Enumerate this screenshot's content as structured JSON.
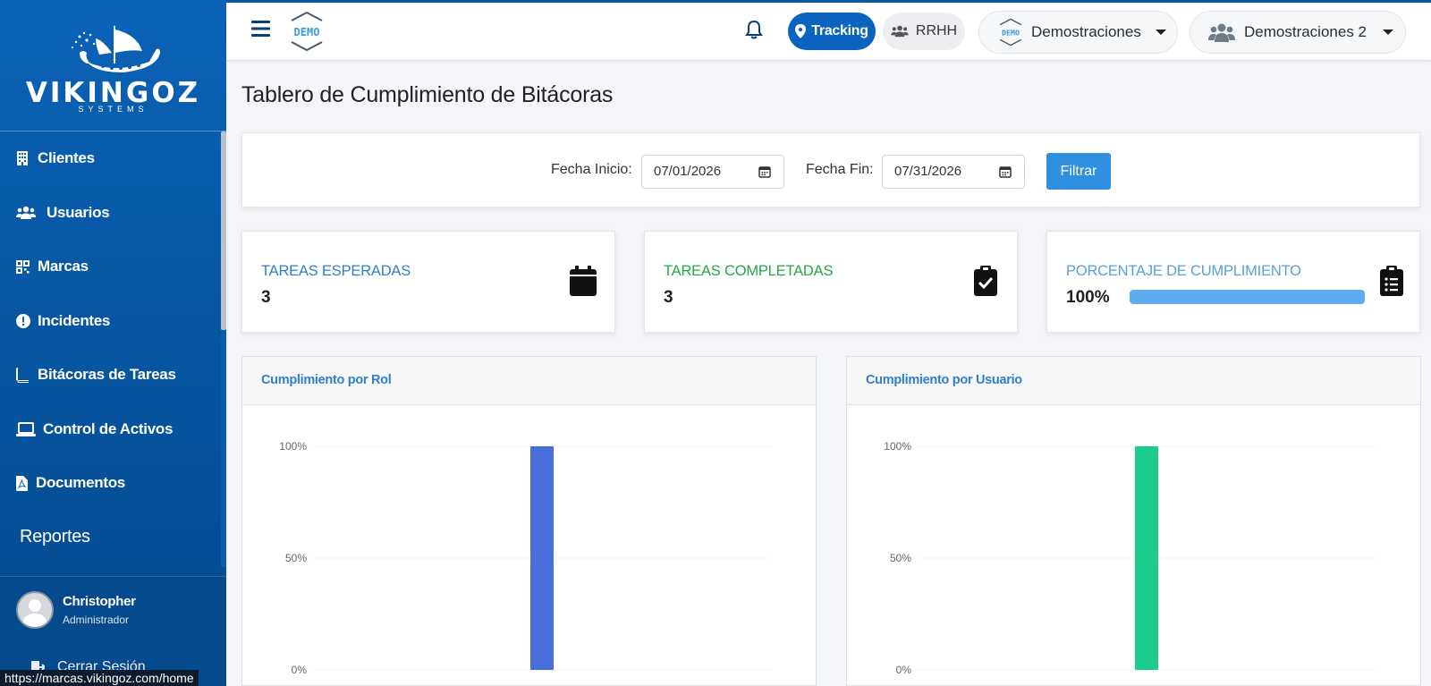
{
  "sidebar": {
    "brand": "VIKINGOZ",
    "brand_sub": "SYSTEMS",
    "items": [
      {
        "label": "Clientes",
        "icon": "building-icon"
      },
      {
        "label": "Usuarios",
        "icon": "users-icon"
      },
      {
        "label": "Marcas",
        "icon": "grid-icon"
      },
      {
        "label": "Incidentes",
        "icon": "alert-circle-icon"
      },
      {
        "label": "Bitácoras de Tareas",
        "icon": "book-icon"
      },
      {
        "label": "Control de Activos",
        "icon": "laptop-icon"
      },
      {
        "label": "Documentos",
        "icon": "pdf-file-icon"
      },
      {
        "label": "Reportes",
        "icon": ""
      }
    ],
    "user": {
      "name": "Christopher",
      "role": "Administrador"
    },
    "logout": "Cerrar Sesión"
  },
  "status_url": "https://marcas.vikingoz.com/home",
  "topbar": {
    "logo_text": "DEMO",
    "tracking": "Tracking",
    "rrhh": "RRHH",
    "company": "Demostraciones",
    "branch": "Demostraciones 2"
  },
  "page": {
    "title": "Tablero de Cumplimiento de Bitácoras"
  },
  "filter": {
    "start_label": "Fecha Inicio:",
    "start_value": "07/01/2026",
    "end_label": "Fecha Fin:",
    "end_value": "07/31/2026",
    "button": "Filtrar"
  },
  "stats": {
    "expected": {
      "title": "TAREAS ESPERADAS",
      "value": "3",
      "color": "#2f7fcb"
    },
    "completed": {
      "title": "TAREAS COMPLETADAS",
      "value": "3",
      "color": "#28a745"
    },
    "percentage": {
      "title": "PORCENTAJE DE CUMPLIMIENTO",
      "value": "100%",
      "fraction": 1.0,
      "color": "#5cacee"
    }
  },
  "chart_data": [
    {
      "type": "bar",
      "title": "Cumplimiento por Rol",
      "categories": [
        ""
      ],
      "values": [
        100
      ],
      "ylim": [
        0,
        100
      ],
      "yticks": [
        "0%",
        "50%",
        "100%"
      ],
      "color": "#4a6fdc",
      "grid": true
    },
    {
      "type": "bar",
      "title": "Cumplimiento por Usuario",
      "categories": [
        ""
      ],
      "values": [
        100
      ],
      "ylim": [
        0,
        100
      ],
      "yticks": [
        "0%",
        "50%",
        "100%"
      ],
      "color": "#1dcb8a",
      "grid": true
    }
  ]
}
